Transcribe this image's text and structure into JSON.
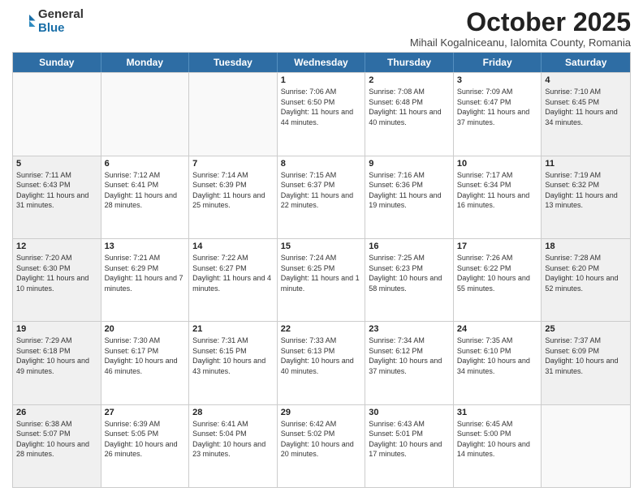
{
  "logo": {
    "general": "General",
    "blue": "Blue"
  },
  "header": {
    "month": "October 2025",
    "location": "Mihail Kogalniceanu, Ialomita County, Romania"
  },
  "weekdays": [
    "Sunday",
    "Monday",
    "Tuesday",
    "Wednesday",
    "Thursday",
    "Friday",
    "Saturday"
  ],
  "weeks": [
    [
      {
        "day": "",
        "info": "",
        "empty": true
      },
      {
        "day": "",
        "info": "",
        "empty": true
      },
      {
        "day": "",
        "info": "",
        "empty": true
      },
      {
        "day": "1",
        "info": "Sunrise: 7:06 AM\nSunset: 6:50 PM\nDaylight: 11 hours and 44 minutes."
      },
      {
        "day": "2",
        "info": "Sunrise: 7:08 AM\nSunset: 6:48 PM\nDaylight: 11 hours and 40 minutes."
      },
      {
        "day": "3",
        "info": "Sunrise: 7:09 AM\nSunset: 6:47 PM\nDaylight: 11 hours and 37 minutes."
      },
      {
        "day": "4",
        "info": "Sunrise: 7:10 AM\nSunset: 6:45 PM\nDaylight: 11 hours and 34 minutes.",
        "shaded": true
      }
    ],
    [
      {
        "day": "5",
        "info": "Sunrise: 7:11 AM\nSunset: 6:43 PM\nDaylight: 11 hours and 31 minutes.",
        "shaded": true
      },
      {
        "day": "6",
        "info": "Sunrise: 7:12 AM\nSunset: 6:41 PM\nDaylight: 11 hours and 28 minutes."
      },
      {
        "day": "7",
        "info": "Sunrise: 7:14 AM\nSunset: 6:39 PM\nDaylight: 11 hours and 25 minutes."
      },
      {
        "day": "8",
        "info": "Sunrise: 7:15 AM\nSunset: 6:37 PM\nDaylight: 11 hours and 22 minutes."
      },
      {
        "day": "9",
        "info": "Sunrise: 7:16 AM\nSunset: 6:36 PM\nDaylight: 11 hours and 19 minutes."
      },
      {
        "day": "10",
        "info": "Sunrise: 7:17 AM\nSunset: 6:34 PM\nDaylight: 11 hours and 16 minutes."
      },
      {
        "day": "11",
        "info": "Sunrise: 7:19 AM\nSunset: 6:32 PM\nDaylight: 11 hours and 13 minutes.",
        "shaded": true
      }
    ],
    [
      {
        "day": "12",
        "info": "Sunrise: 7:20 AM\nSunset: 6:30 PM\nDaylight: 11 hours and 10 minutes.",
        "shaded": true
      },
      {
        "day": "13",
        "info": "Sunrise: 7:21 AM\nSunset: 6:29 PM\nDaylight: 11 hours and 7 minutes."
      },
      {
        "day": "14",
        "info": "Sunrise: 7:22 AM\nSunset: 6:27 PM\nDaylight: 11 hours and 4 minutes."
      },
      {
        "day": "15",
        "info": "Sunrise: 7:24 AM\nSunset: 6:25 PM\nDaylight: 11 hours and 1 minute."
      },
      {
        "day": "16",
        "info": "Sunrise: 7:25 AM\nSunset: 6:23 PM\nDaylight: 10 hours and 58 minutes."
      },
      {
        "day": "17",
        "info": "Sunrise: 7:26 AM\nSunset: 6:22 PM\nDaylight: 10 hours and 55 minutes."
      },
      {
        "day": "18",
        "info": "Sunrise: 7:28 AM\nSunset: 6:20 PM\nDaylight: 10 hours and 52 minutes.",
        "shaded": true
      }
    ],
    [
      {
        "day": "19",
        "info": "Sunrise: 7:29 AM\nSunset: 6:18 PM\nDaylight: 10 hours and 49 minutes.",
        "shaded": true
      },
      {
        "day": "20",
        "info": "Sunrise: 7:30 AM\nSunset: 6:17 PM\nDaylight: 10 hours and 46 minutes."
      },
      {
        "day": "21",
        "info": "Sunrise: 7:31 AM\nSunset: 6:15 PM\nDaylight: 10 hours and 43 minutes."
      },
      {
        "day": "22",
        "info": "Sunrise: 7:33 AM\nSunset: 6:13 PM\nDaylight: 10 hours and 40 minutes."
      },
      {
        "day": "23",
        "info": "Sunrise: 7:34 AM\nSunset: 6:12 PM\nDaylight: 10 hours and 37 minutes."
      },
      {
        "day": "24",
        "info": "Sunrise: 7:35 AM\nSunset: 6:10 PM\nDaylight: 10 hours and 34 minutes."
      },
      {
        "day": "25",
        "info": "Sunrise: 7:37 AM\nSunset: 6:09 PM\nDaylight: 10 hours and 31 minutes.",
        "shaded": true
      }
    ],
    [
      {
        "day": "26",
        "info": "Sunrise: 6:38 AM\nSunset: 5:07 PM\nDaylight: 10 hours and 28 minutes.",
        "shaded": true
      },
      {
        "day": "27",
        "info": "Sunrise: 6:39 AM\nSunset: 5:05 PM\nDaylight: 10 hours and 26 minutes."
      },
      {
        "day": "28",
        "info": "Sunrise: 6:41 AM\nSunset: 5:04 PM\nDaylight: 10 hours and 23 minutes."
      },
      {
        "day": "29",
        "info": "Sunrise: 6:42 AM\nSunset: 5:02 PM\nDaylight: 10 hours and 20 minutes."
      },
      {
        "day": "30",
        "info": "Sunrise: 6:43 AM\nSunset: 5:01 PM\nDaylight: 10 hours and 17 minutes."
      },
      {
        "day": "31",
        "info": "Sunrise: 6:45 AM\nSunset: 5:00 PM\nDaylight: 10 hours and 14 minutes."
      },
      {
        "day": "",
        "info": "",
        "empty": true,
        "shaded": true
      }
    ]
  ]
}
